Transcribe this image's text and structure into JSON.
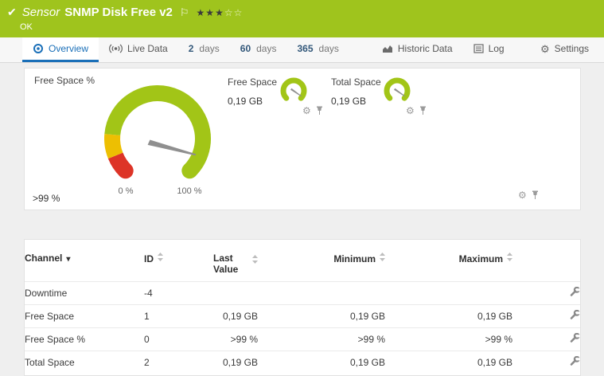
{
  "header": {
    "kind": "Sensor",
    "title": "SNMP Disk Free v2",
    "status": "OK",
    "stars_filled": "★★★",
    "stars_empty": "☆☆"
  },
  "tabs": [
    {
      "label": "Overview",
      "active": true
    },
    {
      "label": "Live Data",
      "active": false
    },
    {
      "num": "2",
      "label": "days",
      "active": false
    },
    {
      "num": "60",
      "label": "days",
      "active": false
    },
    {
      "num": "365",
      "label": "days",
      "active": false
    },
    {
      "label": "Historic Data",
      "active": false
    },
    {
      "label": "Log",
      "active": false
    },
    {
      "label": "Settings",
      "active": false
    }
  ],
  "gauges": {
    "main": {
      "title": "Free Space %",
      "value": ">99 %",
      "scale_min": "0 %",
      "scale_max": "100 %"
    },
    "mini": [
      {
        "title": "Free Space",
        "value": "0,19 GB"
      },
      {
        "title": "Total Space",
        "value": "0,19 GB"
      }
    ]
  },
  "table": {
    "headers": {
      "channel": "Channel",
      "id": "ID",
      "last": "Last Value",
      "min": "Minimum",
      "max": "Maximum"
    },
    "rows": [
      {
        "channel": "Downtime",
        "id": "-4",
        "last": "",
        "min": "",
        "max": ""
      },
      {
        "channel": "Free Space",
        "id": "1",
        "last": "0,19 GB",
        "min": "0,19 GB",
        "max": "0,19 GB"
      },
      {
        "channel": "Free Space %",
        "id": "0",
        "last": ">99 %",
        "min": ">99 %",
        "max": ">99 %"
      },
      {
        "channel": "Total Space",
        "id": "2",
        "last": "0,19 GB",
        "min": "0,19 GB",
        "max": "0,19 GB"
      }
    ]
  },
  "colors": {
    "header_green": "#9fc41d",
    "accent_blue": "#1a6fb8",
    "gauge_green": "#a2c517",
    "gauge_yellow": "#edbf02",
    "gauge_red": "#dd3427",
    "needle_gray": "#8f8f8f"
  }
}
